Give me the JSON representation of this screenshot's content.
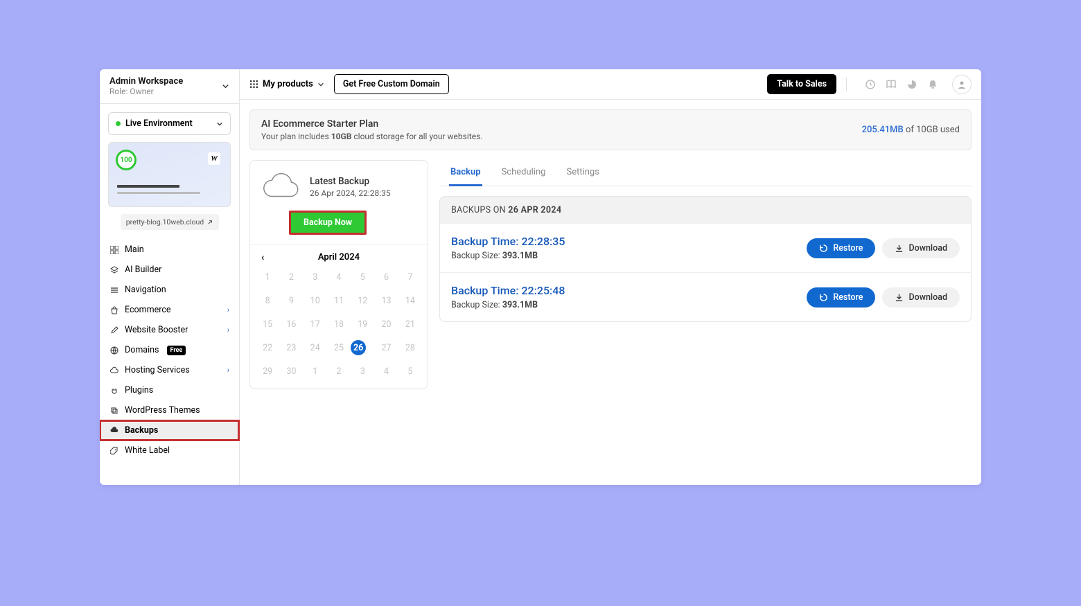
{
  "workspace": {
    "title": "Admin Workspace",
    "role": "Role: Owner"
  },
  "env": {
    "label": "Live Environment"
  },
  "preview": {
    "score": "100",
    "domain": "pretty-blog.10web.cloud"
  },
  "nav": {
    "main": "Main",
    "ai_builder": "AI Builder",
    "navigation": "Navigation",
    "ecommerce": "Ecommerce",
    "website_booster": "Website Booster",
    "domains": "Domains",
    "domains_pill": "Free",
    "hosting": "Hosting Services",
    "plugins": "Plugins",
    "themes": "WordPress Themes",
    "backups": "Backups",
    "white_label": "White Label"
  },
  "top": {
    "my_products": "My products",
    "custom_domain": "Get Free Custom Domain",
    "talk_to_sales": "Talk to Sales"
  },
  "plan": {
    "title": "AI Ecommerce Starter Plan",
    "desc_prefix": "Your plan includes ",
    "desc_bold": "10GB",
    "desc_suffix": " cloud storage for all your websites.",
    "usage_amt": "205.41MB",
    "usage_suffix": " of 10GB used"
  },
  "backup_panel": {
    "latest_label": "Latest Backup",
    "latest_date": "26 Apr 2024, 22:28:35",
    "button": "Backup Now"
  },
  "calendar": {
    "month": "April 2024",
    "days": [
      "1",
      "2",
      "3",
      "4",
      "5",
      "6",
      "7",
      "8",
      "9",
      "10",
      "11",
      "12",
      "13",
      "14",
      "15",
      "16",
      "17",
      "18",
      "19",
      "20",
      "21",
      "22",
      "23",
      "24",
      "25",
      "26",
      "27",
      "28",
      "29",
      "30",
      "1",
      "2",
      "3",
      "4",
      "5"
    ],
    "selected": "26"
  },
  "tabs": {
    "backup": "Backup",
    "scheduling": "Scheduling",
    "settings": "Settings"
  },
  "list": {
    "head_prefix": "BACKUPS ON ",
    "head_date": "26 APR 2024",
    "rows": [
      {
        "time_label": "Backup Time: 22:28:35",
        "size_label": "Backup Size: ",
        "size_value": "393.1MB"
      },
      {
        "time_label": "Backup Time: 22:25:48",
        "size_label": "Backup Size: ",
        "size_value": "393.1MB"
      }
    ],
    "restore": "Restore",
    "download": "Download"
  }
}
